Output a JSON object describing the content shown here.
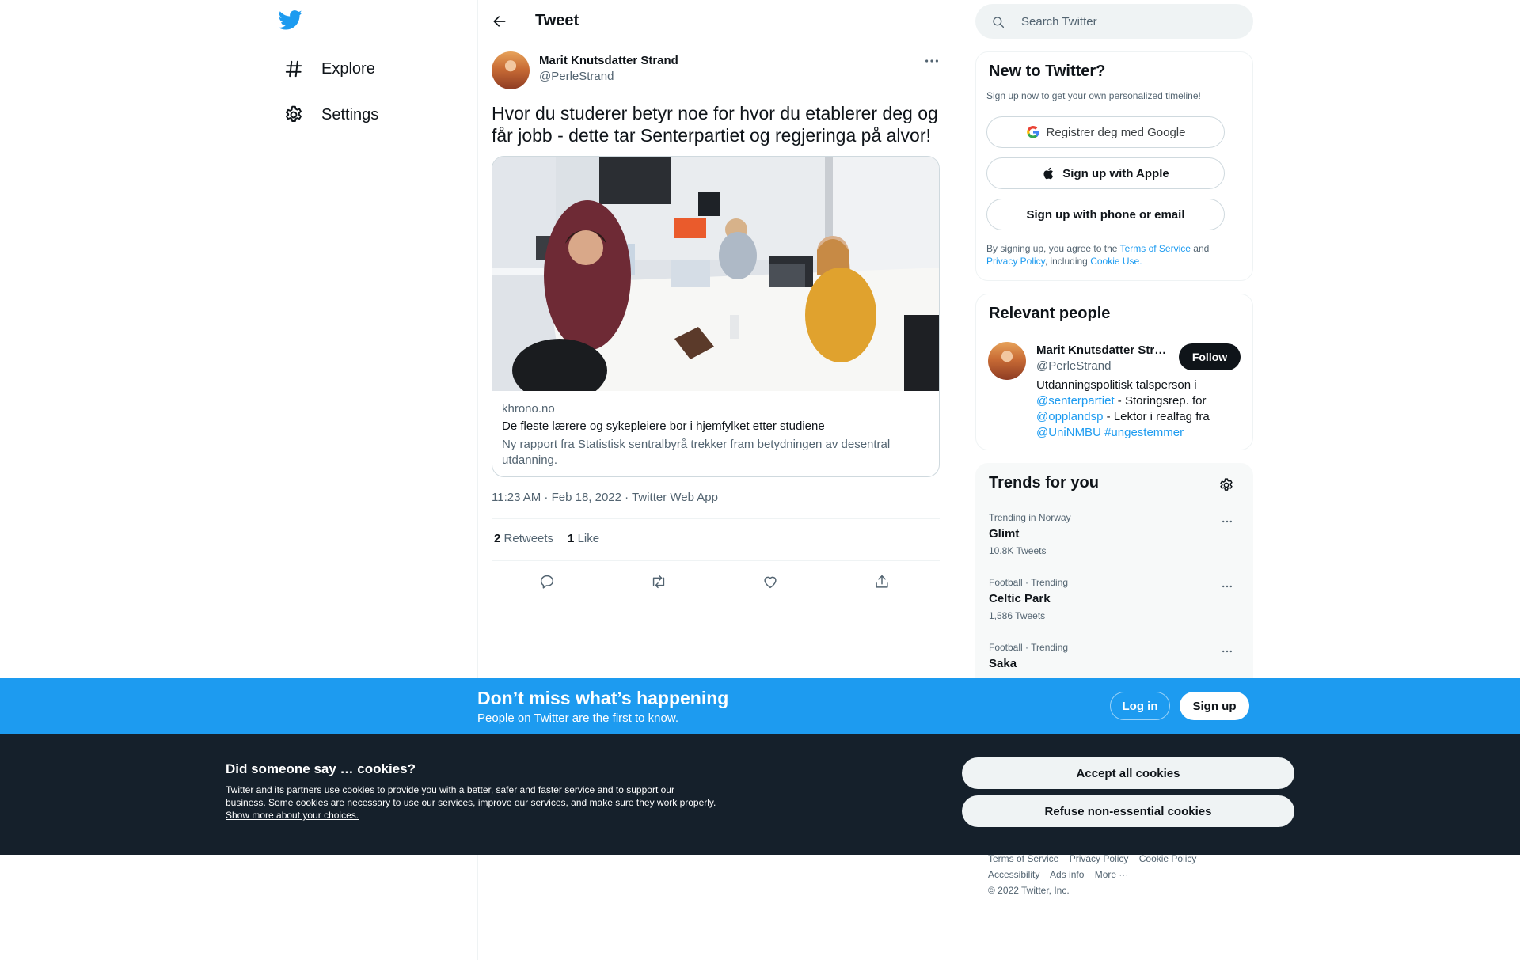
{
  "nav": {
    "logo": "twitter-bird-icon",
    "items": [
      {
        "label": "Explore",
        "icon": "hashtag-icon"
      },
      {
        "label": "Settings",
        "icon": "gear-icon"
      }
    ]
  },
  "header": {
    "title": "Tweet"
  },
  "tweet": {
    "author_name": "Marit Knutsdatter Strand",
    "author_handle": "@PerleStrand",
    "text": "Hvor du studerer betyr noe for hvor du etablerer deg og får jobb - dette tar Senterpartiet og regjeringa på alvor!",
    "card": {
      "domain": "khrono.no",
      "title": "De fleste lærere og sykepleiere bor i hjemfylket etter studiene",
      "description": "Ny rapport fra Statistisk sentralbyrå trekker fram betydningen av desentral utdanning."
    },
    "meta": "11:23 AM · Feb 18, 2022 · Twitter Web App",
    "retweets_count": "2",
    "retweets_label": "Retweets",
    "likes_count": "1",
    "likes_label": "Like"
  },
  "search": {
    "placeholder": "Search Twitter"
  },
  "new_to_twitter": {
    "title": "New to Twitter?",
    "subtitle": "Sign up now to get your own personalized timeline!",
    "google_label": "Registrer deg med Google",
    "apple_label": "Sign up with Apple",
    "phone_label": "Sign up with phone or email",
    "terms_prefix": "By signing up, you agree to the",
    "terms_link": "Terms of Service",
    "terms_and": "and",
    "privacy_link": "Privacy Policy",
    "including": ", including",
    "cookie_link": "Cookie Use."
  },
  "relevant_people": {
    "title": "Relevant people",
    "name": "Marit Knutsdatter Strand",
    "handle": "@PerleStrand",
    "follow_label": "Follow",
    "bio_1": "Utdanningspolitisk talsperson i",
    "bio_link_1": "@senterpartiet",
    "bio_2": " - Storingsrep. for",
    "bio_link_2": "@opplandsp",
    "bio_3": " - Lektor i realfag fra",
    "bio_link_3": "@UniNMBU",
    "bio_link_4": "#ungestemmer"
  },
  "trends": {
    "title": "Trends for you",
    "items": [
      {
        "context": "Trending in Norway",
        "name": "Glimt",
        "count": "10.8K Tweets"
      },
      {
        "context": "Football · Trending",
        "name": "Celtic Park",
        "count": "1,586 Tweets"
      },
      {
        "context": "Football · Trending",
        "name": "Saka",
        "count": ""
      }
    ]
  },
  "footer": {
    "links_1": [
      "Terms of Service",
      "Privacy Policy",
      "Cookie Policy"
    ],
    "links_2": [
      "Accessibility",
      "Ads info",
      "More ···"
    ],
    "copyright": "© 2022 Twitter, Inc."
  },
  "banner": {
    "title": "Don’t miss what’s happening",
    "subtitle": "People on Twitter are the first to know.",
    "login_label": "Log in",
    "signup_label": "Sign up"
  },
  "cookies": {
    "title": "Did someone say … cookies?",
    "text": "Twitter and its partners use cookies to provide you with a better, safer and faster service and to support our business. Some cookies are necessary to use our services, improve our services, and make sure they work properly.",
    "link": "Show more about your choices.",
    "accept_label": "Accept all cookies",
    "refuse_label": "Refuse non-essential cookies"
  },
  "colors": {
    "accent": "#1d9bf0",
    "text": "#0f1419",
    "secondary": "#536471",
    "cookie_bg": "#15202b"
  }
}
